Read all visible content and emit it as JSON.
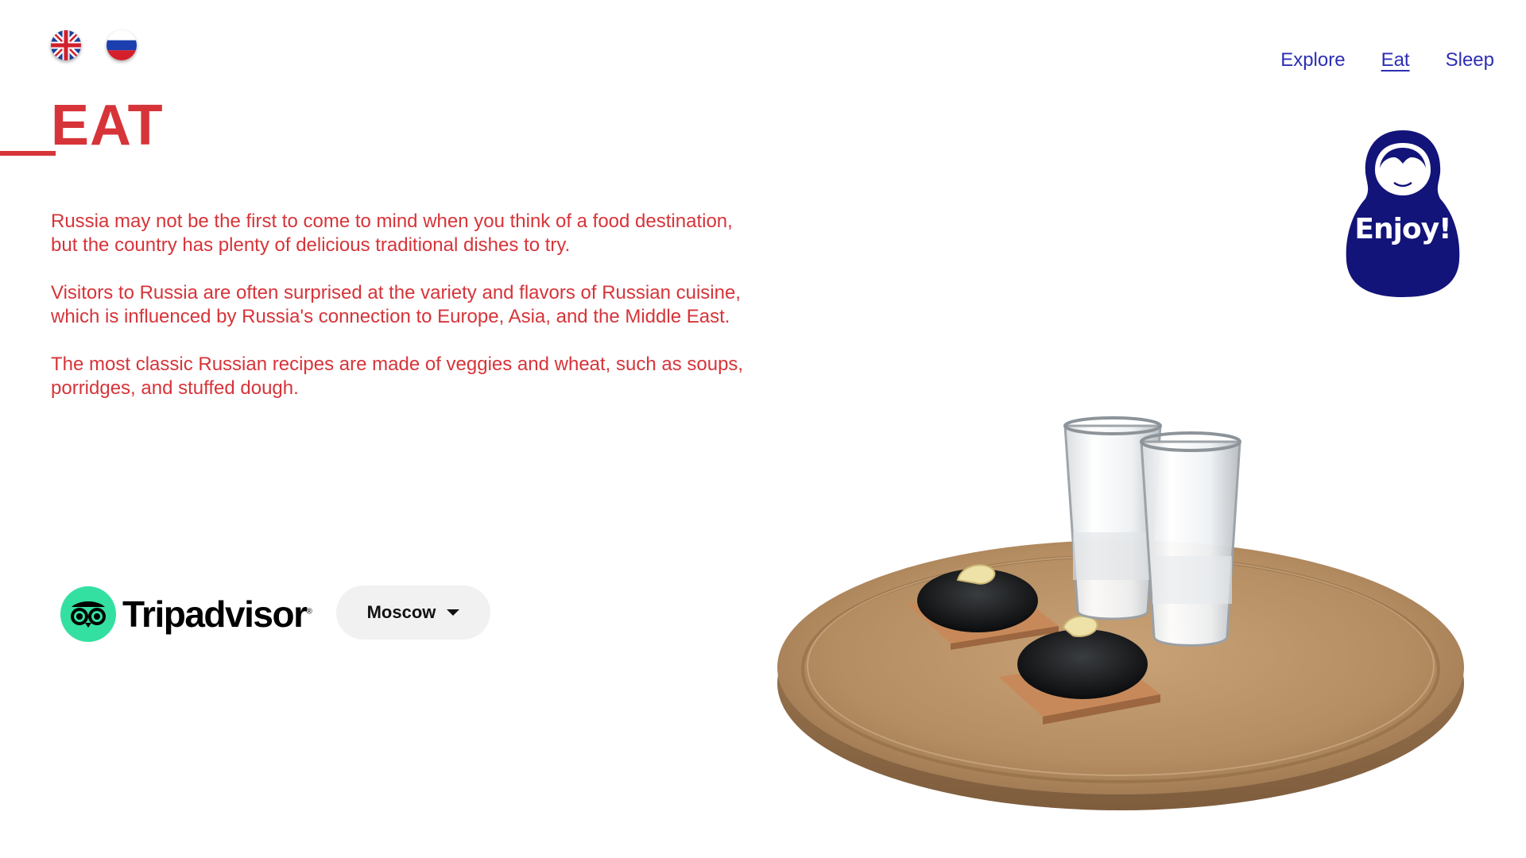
{
  "languages": [
    {
      "code": "en",
      "icon": "uk-flag-icon"
    },
    {
      "code": "ru",
      "icon": "russia-flag-icon"
    }
  ],
  "nav": {
    "items": [
      "Explore",
      "Eat",
      "Sleep"
    ],
    "active": "Eat"
  },
  "page": {
    "title": "EAT",
    "paragraphs": [
      "Russia may not be the first to come to mind when you think of a food destination, but the country has plenty of delicious traditional dishes to try.",
      "Visitors to Russia are often surprised at the variety and flavors of Russian cuisine, which is influenced by Russia's connection to Europe, Asia, and the Middle East.",
      "The most classic Russian recipes are made of veggies and wheat, such as soups, porridges, and stuffed dough."
    ]
  },
  "badge": {
    "text": "Enjoy!",
    "icon": "matryoshka-icon"
  },
  "tripadvisor": {
    "brand": "Tripadvisor",
    "registered": "®",
    "city": "Moscow",
    "logo_icon": "tripadvisor-owl-icon"
  },
  "illustration": {
    "icon": "caviar-vodka-board-illustration"
  },
  "colors": {
    "accent_red": "#d63439",
    "nav_blue": "#2d2fb3",
    "badge_navy": "#131479",
    "tripadvisor_green": "#34e0a1"
  }
}
